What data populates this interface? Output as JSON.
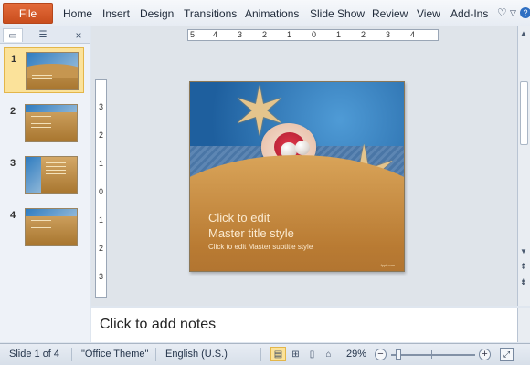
{
  "ribbon": {
    "file_label": "File",
    "tabs": [
      "Home",
      "Insert",
      "Design",
      "Transitions",
      "Animations",
      "Slide Show",
      "Review",
      "View",
      "Add-Ins"
    ],
    "controls": {
      "collapse_icon": "chevron-up-icon",
      "help_icon": "help-icon",
      "heart_icon": "heart-icon"
    }
  },
  "left_pane": {
    "tabs": [
      {
        "icon": "slides-tab-icon"
      },
      {
        "icon": "outline-tab-icon"
      }
    ],
    "close_icon": "close-icon",
    "slides": [
      {
        "number": "1",
        "selected": true
      },
      {
        "number": "2",
        "selected": false
      },
      {
        "number": "3",
        "selected": false
      },
      {
        "number": "4",
        "selected": false
      }
    ]
  },
  "rulers": {
    "horizontal_ticks": [
      "5",
      "4",
      "3",
      "2",
      "1",
      "0",
      "1",
      "2",
      "3",
      "4"
    ],
    "vertical_ticks": [
      "3",
      "2",
      "1",
      "0",
      "1",
      "2",
      "3"
    ]
  },
  "slide": {
    "title_line1": "Click to edit",
    "title_line2": "Master title style",
    "subtitle": "Click to edit  Master subtitle style",
    "brand": "fppt.com"
  },
  "notes": {
    "placeholder": "Click to add notes"
  },
  "status_bar": {
    "slide_info": "Slide 1 of 4",
    "theme": "\"Office Theme\"",
    "language": "English (U.S.)",
    "zoom_percent": "29%",
    "zoom_level": 0.29,
    "views": [
      "normal-view-icon",
      "slide-sorter-icon",
      "reading-view-icon",
      "slide-show-icon"
    ]
  },
  "colors": {
    "file_tab": "#d35a2b",
    "selection": "#fbe29a"
  }
}
